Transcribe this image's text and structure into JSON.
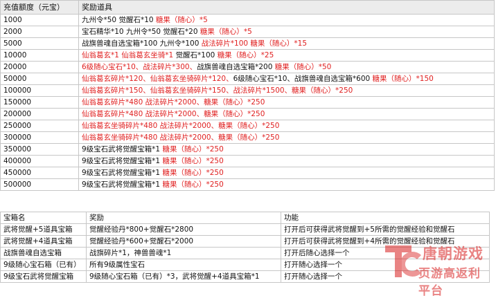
{
  "recharge_table": {
    "headers": [
      "充值额度（元宝）",
      "奖励道具"
    ],
    "rows": [
      {
        "amount": "1000",
        "reward": [
          {
            "t": "九州令*50 觉醒石*10 ",
            "r": false
          },
          {
            "t": "糖果（随心）*5",
            "r": true
          }
        ]
      },
      {
        "amount": "2000",
        "reward": [
          {
            "t": "宝石精华*10 九州令*50 觉醒石*20 ",
            "r": false
          },
          {
            "t": "糖果（随心）*5",
            "r": true
          }
        ]
      },
      {
        "amount": "5000",
        "reward": [
          {
            "t": "战旗兽魂自选宝箱*100 九州令*100 ",
            "r": false
          },
          {
            "t": "战法碎片*100 糖果（随心）*15",
            "r": true
          }
        ]
      },
      {
        "amount": "10000",
        "reward": [
          {
            "t": "仙翁葛玄*1 仙翁葛玄坐骑*1 ",
            "r": true
          },
          {
            "t": "觉醒石*100 ",
            "r": false
          },
          {
            "t": "糖果（随心）*25",
            "r": true
          }
        ]
      },
      {
        "amount": "20000",
        "reward": [
          {
            "t": "6级随心宝石*10、战法碎片*300、",
            "r": true
          },
          {
            "t": "战旗兽魂自选宝箱*200 ",
            "r": false
          },
          {
            "t": "糖果（随心）*50",
            "r": true
          }
        ]
      },
      {
        "amount": "50000",
        "reward": [
          {
            "t": "仙翁葛玄碎片*120、仙翁葛玄坐骑碎片*120、",
            "r": true
          },
          {
            "t": "6级随心宝石*10、战旗兽魂自选宝箱*600 ",
            "r": false
          },
          {
            "t": "糖果（随心）*150",
            "r": true
          }
        ]
      },
      {
        "amount": "100000",
        "reward": [
          {
            "t": "仙翁葛玄碎片*150、仙翁葛玄坐骑碎片*150、战法碎片*1500、糖果（随心）*250",
            "r": true
          }
        ]
      },
      {
        "amount": "150000",
        "reward": [
          {
            "t": "仙翁葛玄碎片*480 战法碎片*2000、糖果（随心）*250",
            "r": true
          }
        ]
      },
      {
        "amount": "200000",
        "reward": [
          {
            "t": "仙翁葛玄碎片*480 战法碎片*2000、糖果（随心）*250",
            "r": true
          }
        ]
      },
      {
        "amount": "250000",
        "reward": [
          {
            "t": "仙翁葛玄坐骑碎片*480 战法碎片*2000、糖果（随心）*250",
            "r": true
          }
        ]
      },
      {
        "amount": "300000",
        "reward": [
          {
            "t": "仙翁葛玄坐骑碎片*480 战法碎片*2000、糖果（随心）*250",
            "r": true
          }
        ]
      },
      {
        "amount": "350000",
        "reward": [
          {
            "t": "9级宝石武将觉醒宝箱*1 ",
            "r": false
          },
          {
            "t": "糖果（随心）*250",
            "r": true
          }
        ]
      },
      {
        "amount": "400000",
        "reward": [
          {
            "t": "9级宝石武将觉醒宝箱*1 ",
            "r": false
          },
          {
            "t": "糖果（随心）*250",
            "r": true
          }
        ]
      },
      {
        "amount": "450000",
        "reward": [
          {
            "t": "9级宝石武将觉醒宝箱*1 ",
            "r": false
          },
          {
            "t": "糖果（随心）*250",
            "r": true
          }
        ]
      },
      {
        "amount": "500000",
        "reward": [
          {
            "t": "9级宝石武将觉醒宝箱*1 ",
            "r": false
          },
          {
            "t": "糖果（随心）*250",
            "r": true
          }
        ]
      }
    ]
  },
  "box_table": {
    "headers": [
      "宝箱名",
      "奖励",
      "功能"
    ],
    "rows": [
      {
        "name": "武将觉醒+5道具宝箱",
        "reward": "觉醒经验丹*800+觉醒石*2800",
        "func": "打开后可获得武将觉醒到+5所需的觉醒经验和觉醒石"
      },
      {
        "name": "武将觉醒+4道具宝箱",
        "reward": "觉醒经验丹*600+觉醒石*2000",
        "func": "打开后可获得武将觉醒到+4所需的觉醒经验和觉醒石"
      },
      {
        "name": "战旗兽魂自选宝箱",
        "reward": "战旗碎片*1，神兽兽魂*1",
        "func": "打开后随心选择一个"
      },
      {
        "name": "9级随心宝石箱（已有）",
        "reward": "所有9级属性宝石",
        "func": "打开随心选择一个"
      },
      {
        "name": "9级宝石武将觉醒宝箱",
        "reward": "9级随心宝石箱（已有）*3，武将觉醒+4道具宝箱*1",
        "func": "打开随心选择一个"
      }
    ]
  },
  "watermark": {
    "logo": "TC",
    "line1": "唐朝游戏",
    "line2": "页游高返利平台",
    "color": "#d81e1e"
  }
}
